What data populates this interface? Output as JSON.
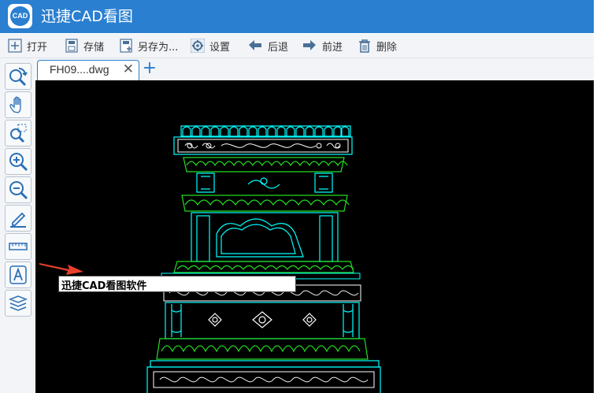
{
  "app": {
    "logo_text": "CAD",
    "title": "迅捷CAD看图"
  },
  "toolbar": {
    "open": "打开",
    "save": "存储",
    "save_as": "另存为...",
    "settings": "设置",
    "back": "后退",
    "forward": "前进",
    "delete": "删除"
  },
  "tabs": {
    "active": "FH09....dwg",
    "close": "✕",
    "new": "+"
  },
  "annotation": {
    "text": "迅捷CAD看图软件"
  },
  "colors": {
    "brand": "#2a7fd0",
    "cad_cyan": "#00ffff",
    "cad_green": "#22dd22",
    "cad_white": "#ffffff",
    "arrow_red": "#e8402c"
  },
  "left_tools": [
    "zoom-previous-icon",
    "pan-hand-icon",
    "zoom-window-icon",
    "zoom-in-icon",
    "zoom-out-icon",
    "annotate-pen-icon",
    "measure-ruler-icon",
    "text-icon",
    "layers-icon"
  ]
}
